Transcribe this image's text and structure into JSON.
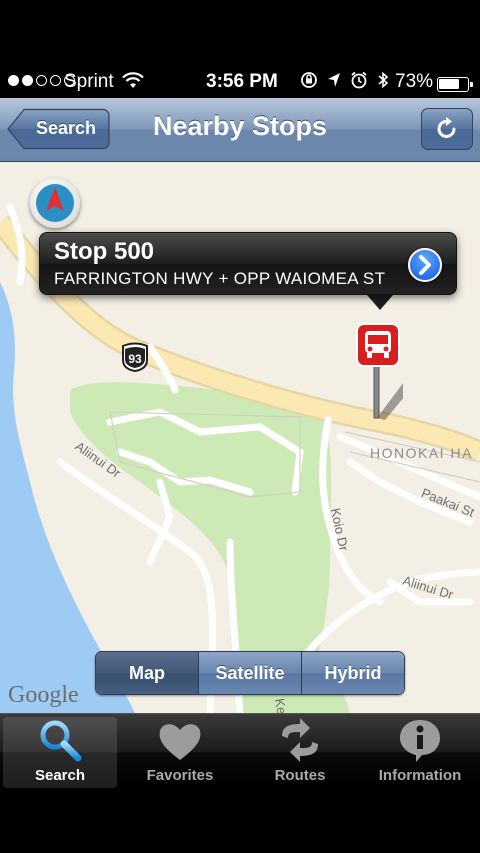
{
  "status_bar": {
    "carrier": "Sprint",
    "time": "3:56 PM",
    "battery_percent": "73%",
    "battery_level": 0.73,
    "signal_bars_filled": 2,
    "signal_bars_total": 5
  },
  "nav": {
    "title": "Nearby Stops",
    "back_label": "Search",
    "refresh_icon": "refresh-icon"
  },
  "map": {
    "callout": {
      "title": "Stop 500",
      "subtitle": "FARRINGTON HWY + OPP WAIOMEA ST"
    },
    "route_shield": "93",
    "labels": {
      "honokai": "HONOKAI HA",
      "paakai": "Paakai St",
      "alinui_left": "Aliinui Dr",
      "alinui_right": "Aliinui Dr",
      "koio": "Koio Dr",
      "kek": "Kek"
    },
    "attribution": "Google",
    "colors": {
      "water": "#9ecbf3",
      "land": "#f4efe4",
      "park": "#cde9b5",
      "highway": "#fbe5a6",
      "pin_red": "#d81e1e"
    }
  },
  "map_type": {
    "options": [
      "Map",
      "Satellite",
      "Hybrid"
    ],
    "selected": "Map"
  },
  "tab_bar": {
    "tabs": [
      {
        "label": "Search",
        "icon": "search-icon",
        "active": true
      },
      {
        "label": "Favorites",
        "icon": "heart-icon",
        "active": false
      },
      {
        "label": "Routes",
        "icon": "routes-arrows-icon",
        "active": false
      },
      {
        "label": "Information",
        "icon": "info-icon",
        "active": false
      }
    ]
  }
}
